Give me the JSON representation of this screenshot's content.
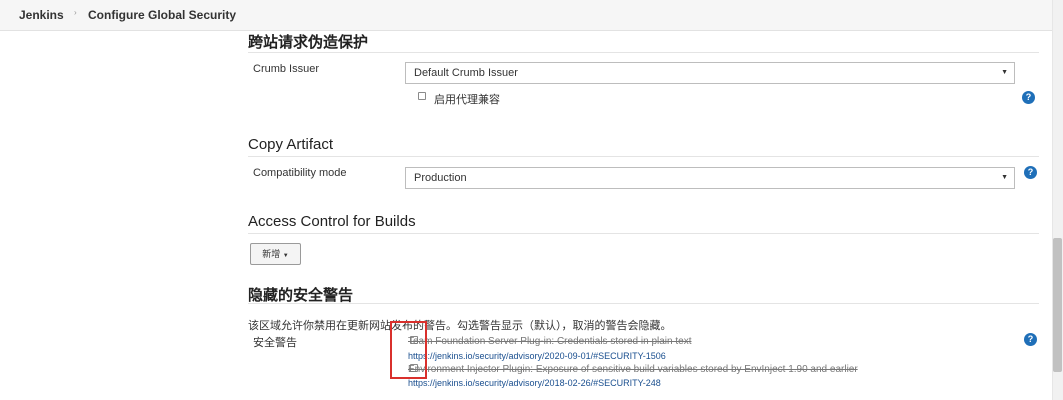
{
  "breadcrumb": {
    "home": "Jenkins",
    "current": "Configure Global Security"
  },
  "csrf": {
    "title": "跨站请求伪造保护",
    "crumb_issuer_label": "Crumb Issuer",
    "crumb_issuer_value": "Default Crumb Issuer",
    "proxy_compat_label": "启用代理兼容"
  },
  "copy_artifact": {
    "title": "Copy Artifact",
    "mode_label": "Compatibility mode",
    "mode_value": "Production"
  },
  "access_control": {
    "title": "Access Control for Builds",
    "add_button": "新增"
  },
  "hidden_warnings": {
    "title": "隐藏的安全警告",
    "description": "该区域允许你禁用在更新网站发布的警告。勾选警告显示（默认），取消的警告会隐藏。",
    "label": "安全警告",
    "items": [
      {
        "text": "Team Foundation Server Plug-in: Credentials stored in plain text",
        "link": "https://jenkins.io/security/advisory/2020-09-01/#SECURITY-1506"
      },
      {
        "text": "Environment Injector Plugin: Exposure of sensitive build variables stored by EnvInject 1.90 and earlier",
        "link": "https://jenkins.io/security/advisory/2018-02-26/#SECURITY-248"
      }
    ]
  },
  "icons": {
    "help": "?",
    "caret": "▼"
  },
  "colors": {
    "help_blue": "#1f6fb8",
    "highlight_red": "#d9302c",
    "link_blue": "#1a4f8f"
  }
}
